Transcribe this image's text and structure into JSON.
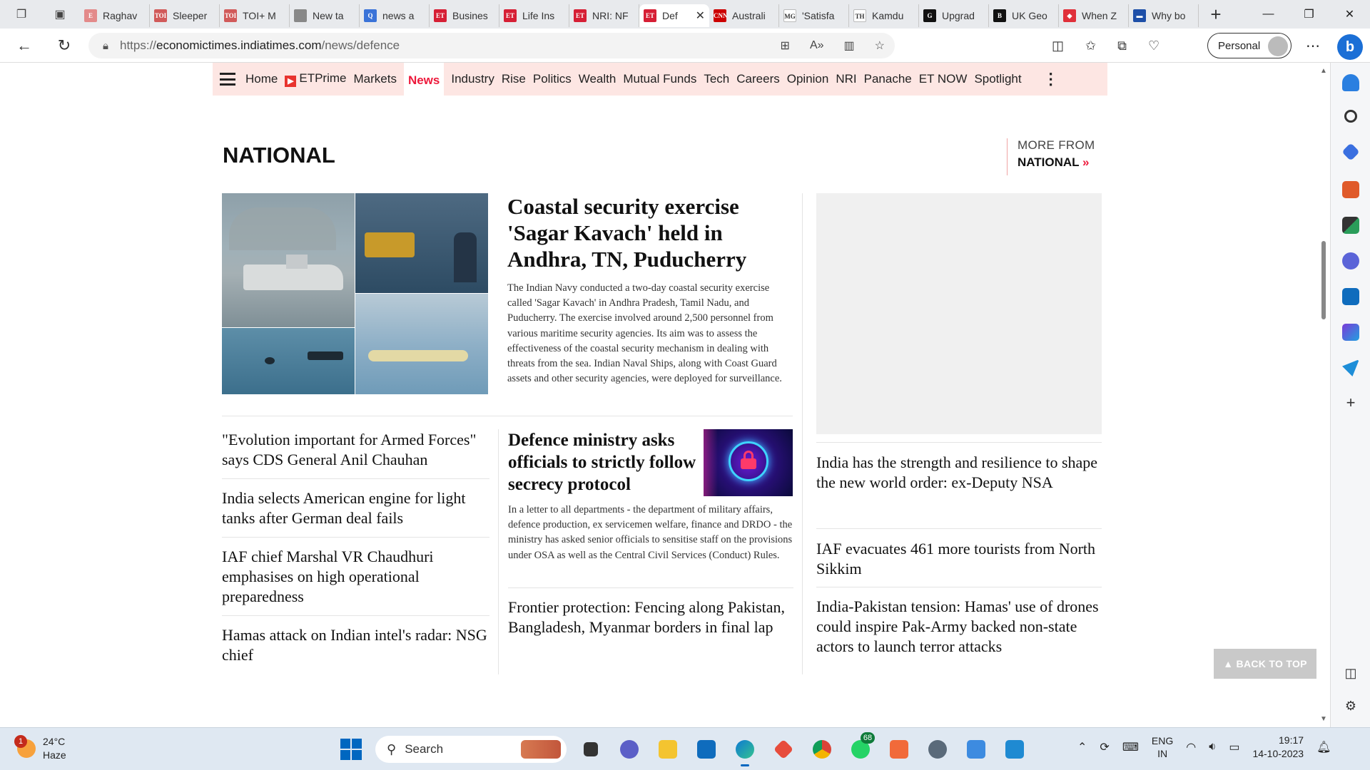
{
  "browser": {
    "tabs": [
      {
        "title": "Raghav",
        "favicon": "E",
        "color": "#e38a8a"
      },
      {
        "title": "Sleeper",
        "favicon": "TOI",
        "color": "#d15a5a"
      },
      {
        "title": "TOI+ M",
        "favicon": "TOI",
        "color": "#d15a5a"
      },
      {
        "title": "New ta",
        "favicon": "",
        "color": "#888888"
      },
      {
        "title": "news a",
        "favicon": "Q",
        "color": "#3a73d8"
      },
      {
        "title": "Busines",
        "favicon": "ET",
        "color": "#d61f35"
      },
      {
        "title": "Life Ins",
        "favicon": "ET",
        "color": "#d61f35"
      },
      {
        "title": "NRI: NF",
        "favicon": "ET",
        "color": "#d61f35"
      },
      {
        "title": "Def",
        "favicon": "ET",
        "color": "#d61f35",
        "active": true
      },
      {
        "title": "Australi",
        "favicon": "CNN",
        "color": "#cc0000"
      },
      {
        "title": "'Satisfa",
        "favicon": "MG",
        "color": "#ffffff"
      },
      {
        "title": "Kamdu",
        "favicon": "TH",
        "color": "#ffffff"
      },
      {
        "title": "Upgrad",
        "favicon": "G",
        "color": "#111111"
      },
      {
        "title": "UK Geo",
        "favicon": "B",
        "color": "#111111"
      },
      {
        "title": "When Z",
        "favicon": "◆",
        "color": "#e0303a"
      },
      {
        "title": "Why bo",
        "favicon": "▬",
        "color": "#1e4fa8"
      }
    ],
    "url_prefix": "https://",
    "url_domain": "economictimes.indiatimes.com",
    "url_path": "/news/defence",
    "profile_label": "Personal"
  },
  "site": {
    "nav": [
      "Home",
      "ETPrime",
      "Markets",
      "News",
      "Industry",
      "Rise",
      "Politics",
      "Wealth",
      "Mutual Funds",
      "Tech",
      "Careers",
      "Opinion",
      "NRI",
      "Panache",
      "ET NOW",
      "Spotlight"
    ],
    "active_nav": "News",
    "section_title": "NATIONAL",
    "more_from_label": "MORE FROM",
    "more_from_section": "NATIONAL"
  },
  "lead": {
    "headline": "Coastal security exercise 'Sagar Kavach' held in Andhra, TN, Puducherry",
    "summary": "The Indian Navy conducted a two-day coastal security exercise called 'Sagar Kavach' in Andhra Pradesh, Tamil Nadu, and Puducherry. The exercise involved around 2,500 personnel from various maritime security agencies. Its aim was to assess the effectiveness of the coastal security mechanism in dealing with threats from the sea. Indian Naval Ships, along with Coast Guard assets and other security agencies, were deployed for surveillance."
  },
  "left_stories": [
    "\"Evolution important for Armed Forces\" says CDS General Anil Chauhan",
    "India selects American engine for light tanks after German deal fails",
    "IAF chief Marshal VR Chaudhuri emphasises on high operational preparedness",
    "Hamas attack on Indian intel's radar: NSG chief"
  ],
  "middle": {
    "headline": "Defence ministry asks officials to strictly follow secrecy protocol",
    "summary": "In a letter to all departments - the department of military affairs, defence production, ex servicemen welfare, finance and DRDO - the ministry has asked senior officials to sensitise staff on the provisions under OSA as well as the Central Civil Services (Conduct) Rules.",
    "story2": "Frontier protection: Fencing along Pakistan, Bangladesh, Myanmar borders in final lap"
  },
  "right_stories": [
    "India has the strength and resilience to shape the new world order: ex-Deputy NSA",
    "IAF evacuates 461 more tourists from North Sikkim",
    "India-Pakistan tension: Hamas' use of drones could inspire Pak-Army backed non-state actors to launch terror attacks"
  ],
  "back_to_top": "▲ BACK TO TOP",
  "taskbar": {
    "weather_temp": "24°C",
    "weather_desc": "Haze",
    "weather_badge": "1",
    "search_placeholder": "Search",
    "whatsapp_badge": "68",
    "lang_1": "ENG",
    "lang_2": "IN",
    "time": "19:17",
    "date": "14-10-2023"
  },
  "colors": {
    "et_red": "#ed193b",
    "nav_bg": "#fde6e3",
    "accent_blue": "#0067c0"
  }
}
